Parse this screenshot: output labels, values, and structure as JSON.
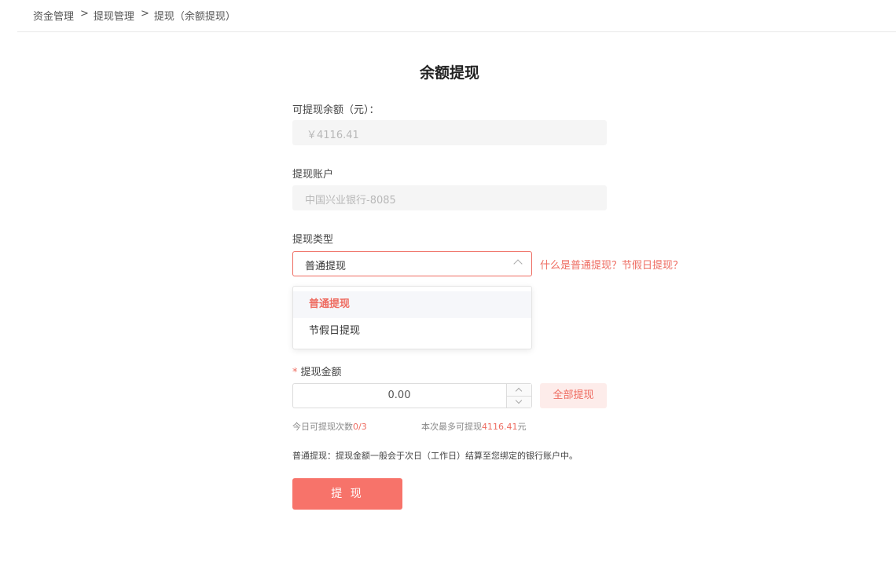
{
  "breadcrumb": {
    "items": [
      "资金管理",
      "提现管理",
      "提现（余额提现）"
    ],
    "separator": ">"
  },
  "page_title": "余额提现",
  "balance": {
    "label": "可提现余额（元）：",
    "value": "￥4116.41"
  },
  "account": {
    "label": "提现账户",
    "value": "中国兴业银行-8085"
  },
  "withdraw_type": {
    "label": "提现类型",
    "selected": "普通提现",
    "help_link": "什么是普通提现？节假日提现？",
    "options": [
      "普通提现",
      "节假日提现"
    ],
    "highlighted_option": "普通提现"
  },
  "amount": {
    "required_mark": "*",
    "label": "提现金额",
    "value": "0.00",
    "all_button": "全部提现"
  },
  "limits": {
    "daily_prefix": "今日可提现次数",
    "daily_count": "0/3",
    "max_prefix": "本次最多可提现",
    "max_amount": "4116.41",
    "max_unit": "元"
  },
  "note": "普通提现：提现金额一般会于次日（工作日）结算至您绑定的银行账户中。",
  "submit_label": "提 现",
  "colors": {
    "accent": "#ee6b60",
    "submit_bg": "#f7736a",
    "all_button_bg": "#fdecea",
    "disabled_bg": "#f5f5f5"
  }
}
